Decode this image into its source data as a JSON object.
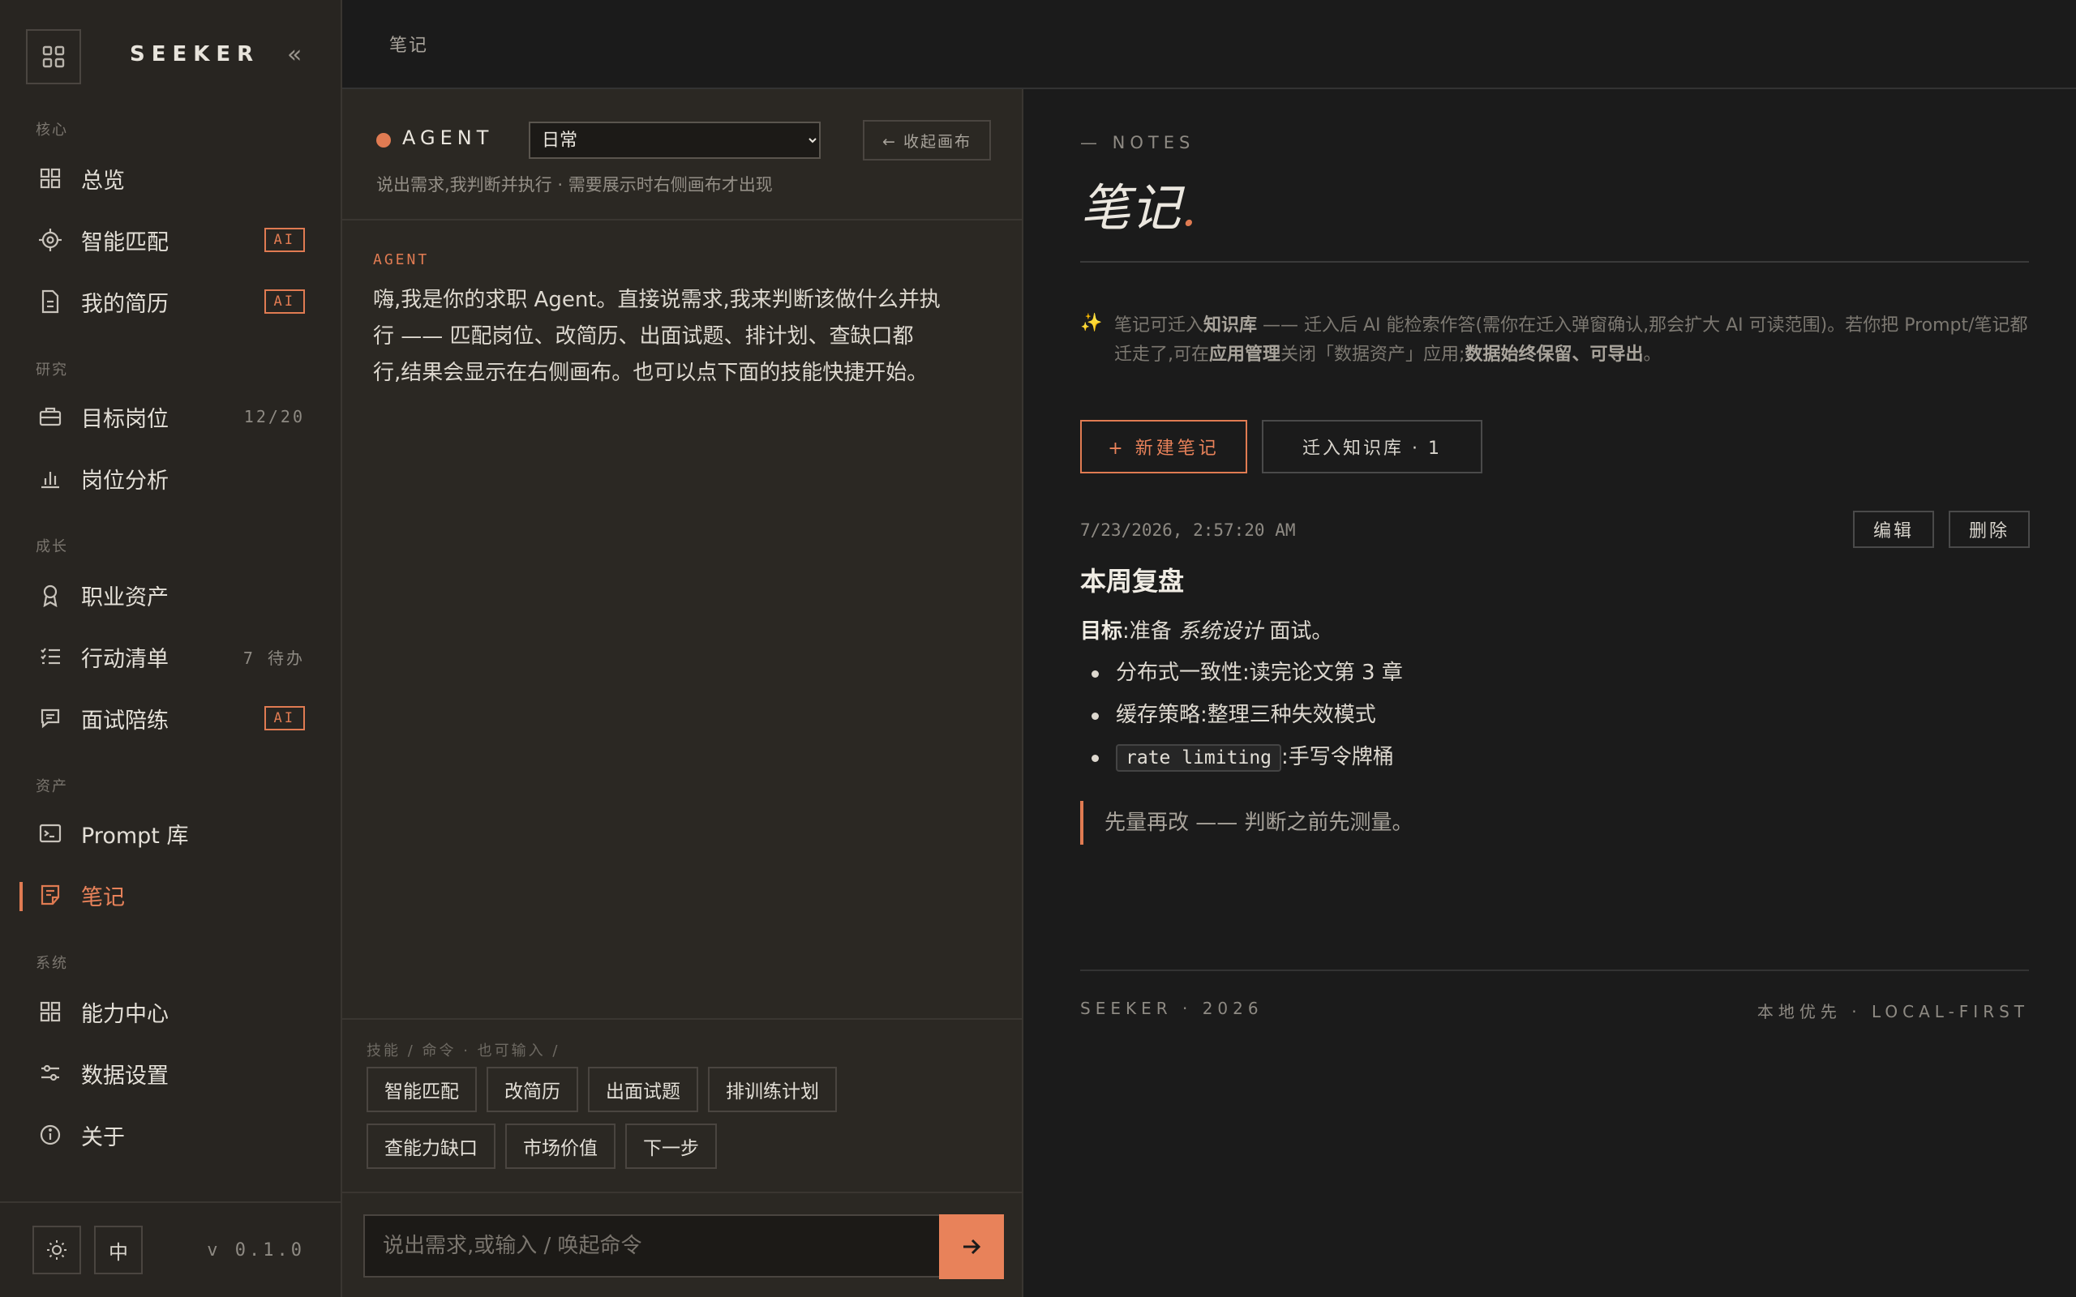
{
  "sidebar": {
    "brand": "SEEKER",
    "collapse_label": "«",
    "sections": {
      "core": "核心",
      "research": "研究",
      "growth": "成长",
      "assets": "资产",
      "system": "系统"
    },
    "items": {
      "overview": "总览",
      "smart_match": "智能匹配",
      "my_resume": "我的简历",
      "target_jobs": "目标岗位",
      "job_analysis": "岗位分析",
      "career_assets": "职业资产",
      "action_list": "行动清单",
      "interview_coach": "面试陪练",
      "prompt_library": "Prompt 库",
      "notes": "笔记",
      "capability_center": "能力中心",
      "data_settings": "数据设置",
      "about": "关于"
    },
    "badges": {
      "ai": "AI",
      "target_jobs_count": "12/20",
      "action_list_count": "7 待办"
    },
    "footer": {
      "lang_label": "中",
      "version": "v 0.1.0"
    }
  },
  "topbar": {
    "breadcrumb": "笔记"
  },
  "agent": {
    "title": "AGENT",
    "mode_selected": "日常",
    "collapse_canvas": "← 收起画布",
    "subtitle": "说出需求,我判断并执行 · 需要展示时右侧画布才出现",
    "message_label": "AGENT",
    "message_text": "嗨,我是你的求职 Agent。直接说需求,我来判断该做什么并执行 —— 匹配岗位、改简历、出面试题、排计划、查缺口都行,结果会显示在右侧画布。也可以点下面的技能快捷开始。",
    "skills_label": "技能 / 命令 · 也可输入 /",
    "skills": {
      "s1": "智能匹配",
      "s2": "改简历",
      "s3": "出面试题",
      "s4": "排训练计划",
      "s5": "查能力缺口",
      "s6": "市场价值",
      "s7": "下一步"
    },
    "input_placeholder": "说出需求,或输入 / 唤起命令"
  },
  "notes": {
    "kicker": "— NOTES",
    "title": "笔记",
    "title_dot": ".",
    "tip": {
      "t1": "笔记可迁入",
      "t2": "知识库",
      "t3": " —— 迁入后 AI 能检索作答(需你在迁入弹窗确认,那会扩大 AI 可读范围)。若你把 Prompt/笔记都迁走了,可在",
      "t4": "应用管理",
      "t5": "关闭「数据资产」应用;",
      "t6": "数据始终保留、可导出",
      "t7": "。"
    },
    "new_note": "+ 新建笔记",
    "migrate": "迁入知识库 · 1",
    "note": {
      "date": "7/23/2026, 2:57:20 AM",
      "edit": "编辑",
      "delete": "删除",
      "heading": "本周复盘",
      "goal_label": "目标",
      "goal_pre": ":准备 ",
      "goal_em": "系统设计",
      "goal_post": " 面试。",
      "item1": "分布式一致性:读完论文第 3 章",
      "item2": "缓存策略:整理三种失效模式",
      "item3_code": "rate limiting",
      "item3_text": ":手写令牌桶",
      "quote": "先量再改 —— 判断之前先测量。"
    },
    "footer_left": "SEEKER · 2026",
    "footer_right": "本地优先 · LOCAL-FIRST"
  },
  "colors": {
    "accent": "#e07b52",
    "sidebar_bg": "#282521",
    "canvas_bg": "#1b1b1b"
  }
}
